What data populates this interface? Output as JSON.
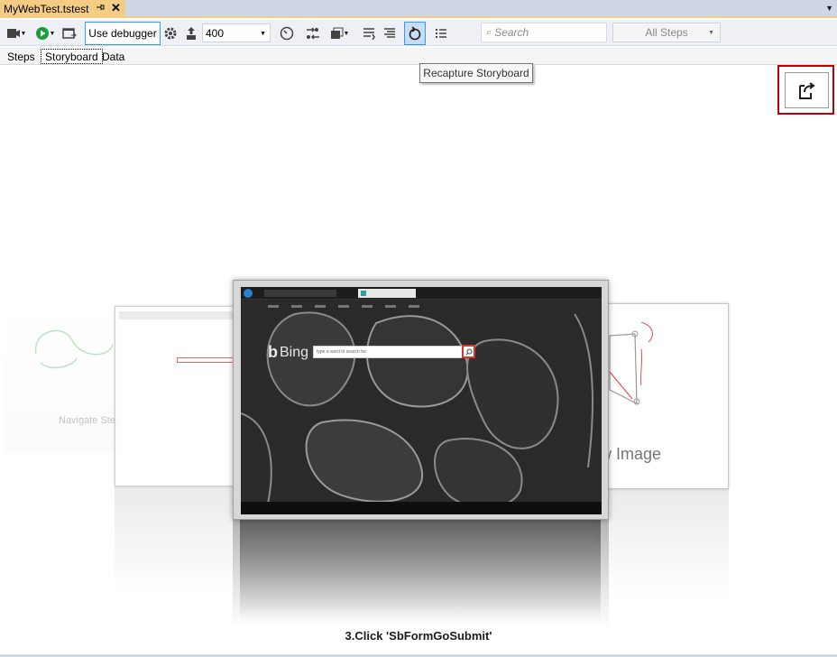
{
  "document_tab": {
    "title": "MyWebTest.tstest",
    "pin_icon": "pin-icon",
    "close_icon": "close-icon"
  },
  "toolbar": {
    "use_debugger_label": "Use debugger",
    "zoom_value": "400",
    "search_placeholder": "Search",
    "filter_value": "All Steps"
  },
  "view_tabs": [
    {
      "label": "Steps",
      "active": false
    },
    {
      "label": "Storyboard",
      "active": true
    },
    {
      "label": "Data",
      "active": false
    }
  ],
  "tooltip": "Recapture Storyboard",
  "storyboard": {
    "left_card_label": "Navigate Step",
    "right_card_label": "w Image",
    "bing_logo": "Bing",
    "bing_search_placeholder": "type a word to search for",
    "caption": "3.Click 'SbFormGoSubmit'"
  },
  "colors": {
    "tab_active": "#f5cc84",
    "accent": "#3399ff",
    "highlight_border": "#c00000"
  }
}
